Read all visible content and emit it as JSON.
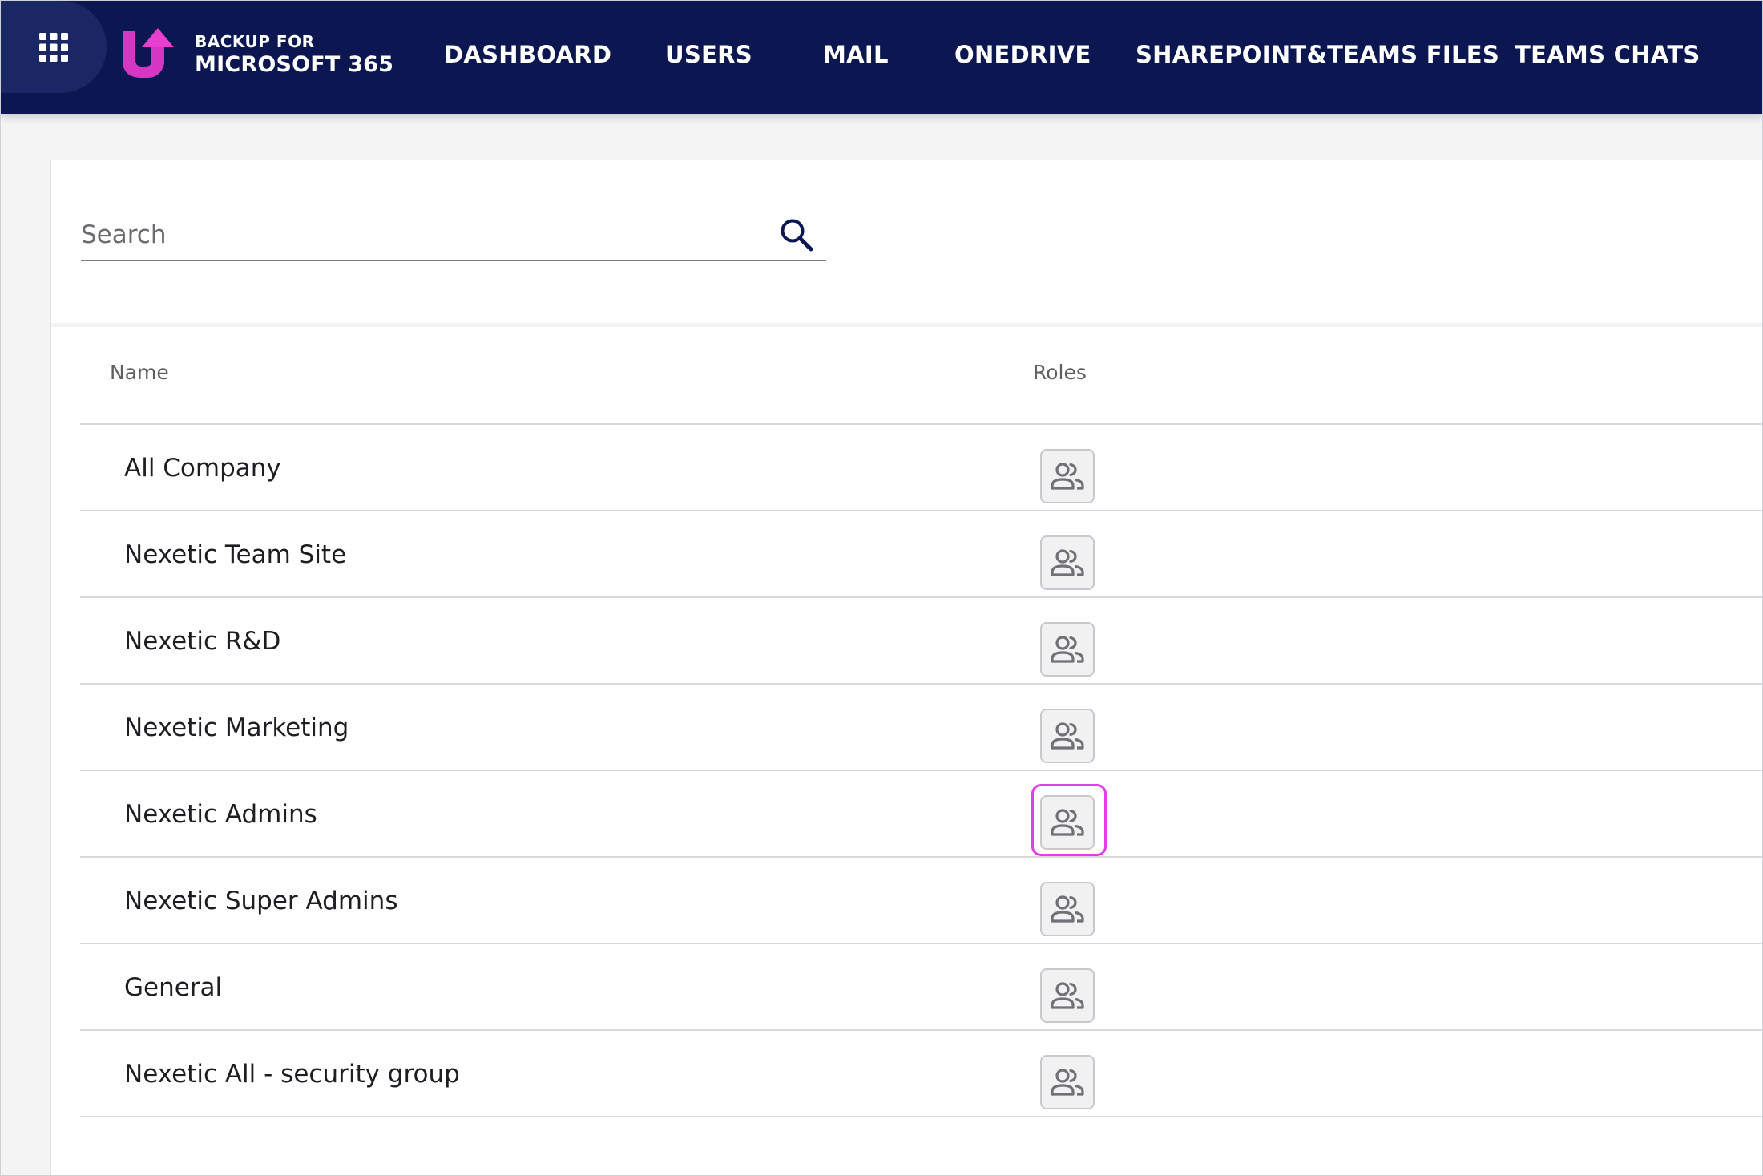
{
  "app": {
    "logo_line1": "BACKUP FOR",
    "logo_line2": "MICROSOFT 365",
    "brand_colors": {
      "nav_background": "#0c1650",
      "logo_pink": "#e83fd0",
      "highlight": "#e040e8"
    }
  },
  "header": {
    "apps_icon": "grid-icon",
    "nav": [
      {
        "label": "DASHBOARD"
      },
      {
        "label": "USERS"
      },
      {
        "label": "MAIL"
      },
      {
        "label": "ONEDRIVE"
      },
      {
        "label": "SHAREPOINT&TEAMS FILES"
      },
      {
        "label": "TEAMS CHATS"
      }
    ]
  },
  "search": {
    "placeholder": "Search",
    "value": "",
    "icon": "search-icon"
  },
  "table": {
    "columns": [
      "Name",
      "Roles"
    ],
    "role_icon": "group-icon",
    "rows": [
      {
        "name": "All Company"
      },
      {
        "name": "Nexetic Team Site"
      },
      {
        "name": "Nexetic R&D"
      },
      {
        "name": "Nexetic Marketing"
      },
      {
        "name": "Nexetic Admins",
        "highlighted": true
      },
      {
        "name": "Nexetic Super Admins"
      },
      {
        "name": "General"
      },
      {
        "name": "Nexetic All - security group"
      }
    ]
  }
}
